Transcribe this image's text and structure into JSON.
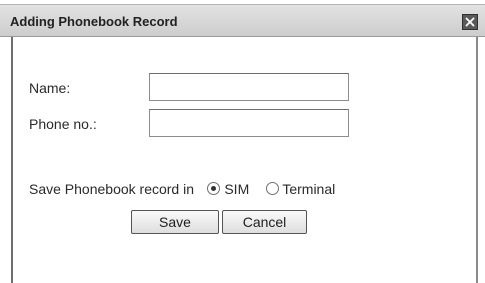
{
  "dialog": {
    "title": "Adding Phonebook Record",
    "close_icon": "close-icon"
  },
  "form": {
    "name_label": "Name:",
    "name_value": "",
    "phone_label": "Phone no.:",
    "phone_value": "",
    "save_in_label": "Save Phonebook record in",
    "options": [
      {
        "label": "SIM",
        "selected": true
      },
      {
        "label": "Terminal",
        "selected": false
      }
    ]
  },
  "buttons": {
    "save": "Save",
    "cancel": "Cancel"
  }
}
